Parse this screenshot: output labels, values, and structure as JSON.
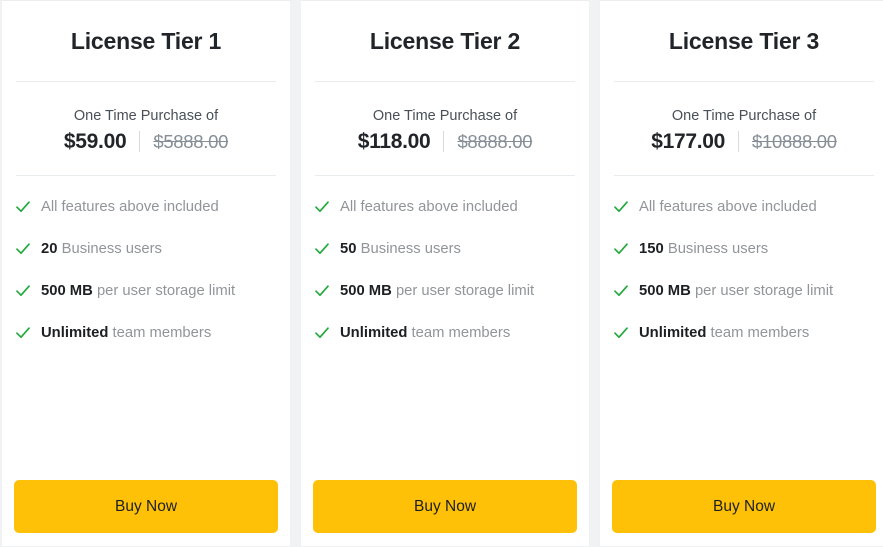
{
  "colors": {
    "accent": "#ffc107",
    "check": "#22a93b",
    "title": "#212529",
    "muted": "#868e96",
    "card_bg": "#ffffff",
    "page_bg": "#f1f2f4"
  },
  "icons": {
    "check": "check-icon"
  },
  "tiers": [
    {
      "title": "License Tier 1",
      "price_caption": "One Time Purchase of",
      "price_current": "$59.00",
      "price_old": "$5888.00",
      "features": [
        {
          "bold": "",
          "text": "All features above included"
        },
        {
          "bold": "20",
          "text": "Business users"
        },
        {
          "bold": "500 MB",
          "text": "per user storage limit"
        },
        {
          "bold": "Unlimited",
          "text": "team members"
        }
      ],
      "cta": "Buy Now"
    },
    {
      "title": "License Tier 2",
      "price_caption": "One Time Purchase of",
      "price_current": "$118.00",
      "price_old": "$8888.00",
      "features": [
        {
          "bold": "",
          "text": "All features above included"
        },
        {
          "bold": "50",
          "text": "Business users"
        },
        {
          "bold": "500 MB",
          "text": "per user storage limit"
        },
        {
          "bold": "Unlimited",
          "text": "team members"
        }
      ],
      "cta": "Buy Now"
    },
    {
      "title": "License Tier 3",
      "price_caption": "One Time Purchase of",
      "price_current": "$177.00",
      "price_old": "$10888.00",
      "features": [
        {
          "bold": "",
          "text": "All features above included"
        },
        {
          "bold": "150",
          "text": "Business users"
        },
        {
          "bold": "500 MB",
          "text": "per user storage limit"
        },
        {
          "bold": "Unlimited",
          "text": "team members"
        }
      ],
      "cta": "Buy Now"
    }
  ]
}
